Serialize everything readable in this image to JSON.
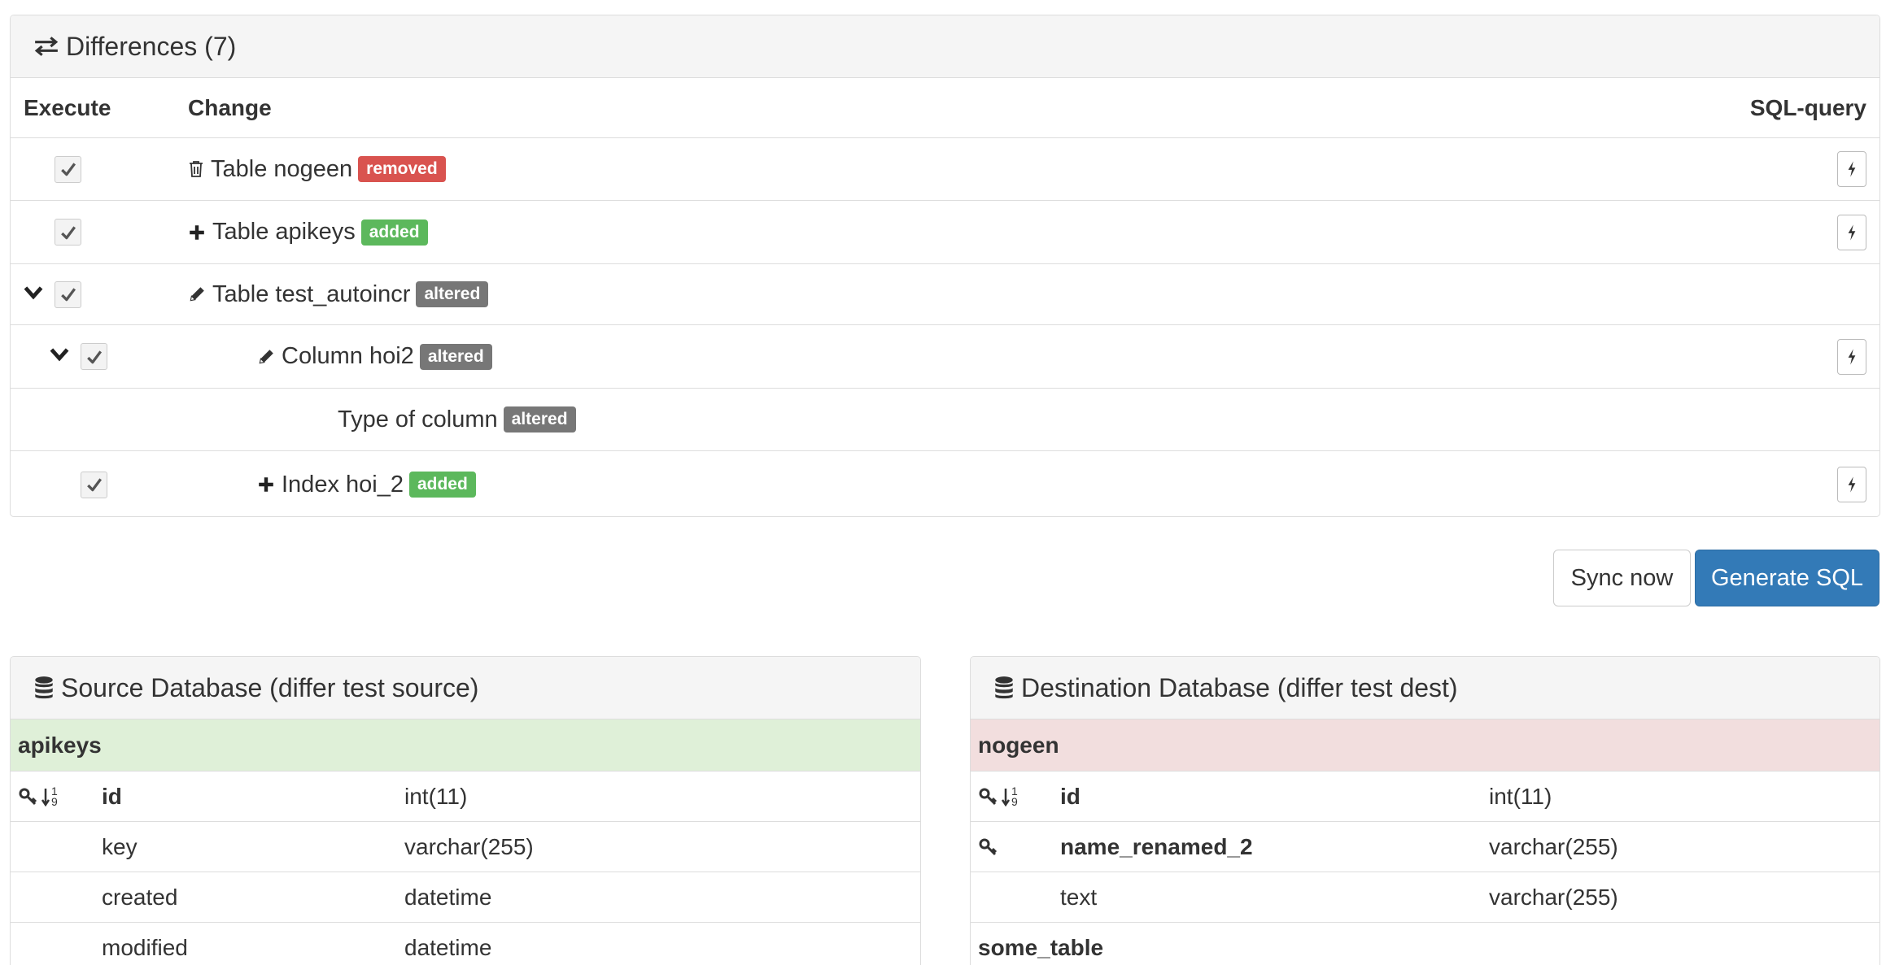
{
  "differences": {
    "title": "Differences (7)",
    "columns": {
      "execute": "Execute",
      "change": "Change",
      "sql": "SQL-query"
    },
    "rows": [
      {
        "label": "Table nogeen",
        "badge": "removed"
      },
      {
        "label": "Table apikeys",
        "badge": "added"
      },
      {
        "label": "Table test_autoincr",
        "badge": "altered"
      },
      {
        "label": "Column hoi2",
        "badge": "altered"
      },
      {
        "label": "Type of column",
        "badge": "altered"
      },
      {
        "label": "Index hoi_2",
        "badge": "added"
      }
    ]
  },
  "actions": {
    "sync": "Sync now",
    "generate": "Generate SQL"
  },
  "source": {
    "title": "Source Database (differ test source)",
    "table": "apikeys",
    "columns": [
      {
        "name": "id",
        "type": "int(11)"
      },
      {
        "name": "key",
        "type": "varchar(255)"
      },
      {
        "name": "created",
        "type": "datetime"
      },
      {
        "name": "modified",
        "type": "datetime"
      }
    ]
  },
  "destination": {
    "title": "Destination Database (differ test dest)",
    "table": "nogeen",
    "columns": [
      {
        "name": "id",
        "type": "int(11)"
      },
      {
        "name": "name_renamed_2",
        "type": "varchar(255)"
      },
      {
        "name": "text",
        "type": "varchar(255)"
      }
    ],
    "table2": "some_table"
  },
  "sort_icon_digits": {
    "top": "1",
    "bottom": "9"
  },
  "colors": {
    "primary": "#337ab7",
    "danger": "#d9534f",
    "success": "#5cb85c",
    "muted": "#777777",
    "added_row": "#dff0d8",
    "removed_row": "#f2dede"
  }
}
